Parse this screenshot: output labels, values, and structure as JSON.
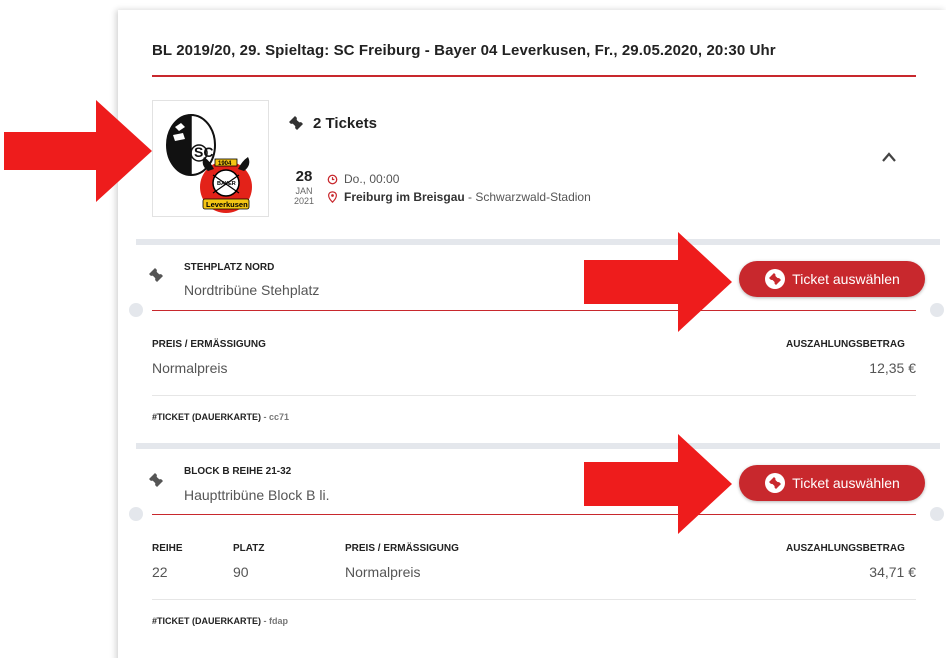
{
  "event": {
    "title": "BL 2019/20, 29. Spieltag: SC Freiburg - Bayer 04 Leverkusen, Fr., 29.05.2020, 20:30 Uhr",
    "tickets_count": "2 Tickets",
    "date": {
      "day": "28",
      "month": "JAN",
      "year": "2021"
    },
    "time": "Do., 00:00",
    "venue_city": "Freiburg im Breisgau",
    "venue_separator": " - ",
    "venue_stadium": "Schwarzwald-Stadion"
  },
  "logos": {
    "freiburg_initials": "SC",
    "leverkusen_top": "1904",
    "leverkusen_mid": "BAYER",
    "leverkusen_band": "Leverkusen"
  },
  "tickets": [
    {
      "section": "STEHPLATZ NORD",
      "area": "Nordtribüne Stehplatz",
      "button": "Ticket auswählen",
      "price_label": "PREIS / ERMÄSSIGUNG",
      "price_value": "Normalpreis",
      "payout_label": "AUSZAHLUNGSBETRAG",
      "payout_value": "12,35 €",
      "id_label": "#TICKET (DAUERKARTE)",
      "id_sep": " - ",
      "id_code": "cc71"
    },
    {
      "section": "BLOCK B REIHE 21-32",
      "area": "Haupttribüne Block B li.",
      "button": "Ticket auswählen",
      "row_label": "REIHE",
      "row_value": "22",
      "seat_label": "PLATZ",
      "seat_value": "90",
      "price_label": "PREIS / ERMÄSSIGUNG",
      "price_value": "Normalpreis",
      "payout_label": "AUSZAHLUNGSBETRAG",
      "payout_value": "34,71 €",
      "id_label": "#TICKET (DAUERKARTE)",
      "id_sep": " - ",
      "id_code": "fdap"
    }
  ],
  "colors": {
    "accent": "#c8282d",
    "arrow": "#ee1c1c",
    "band": "#e4e7ec"
  }
}
